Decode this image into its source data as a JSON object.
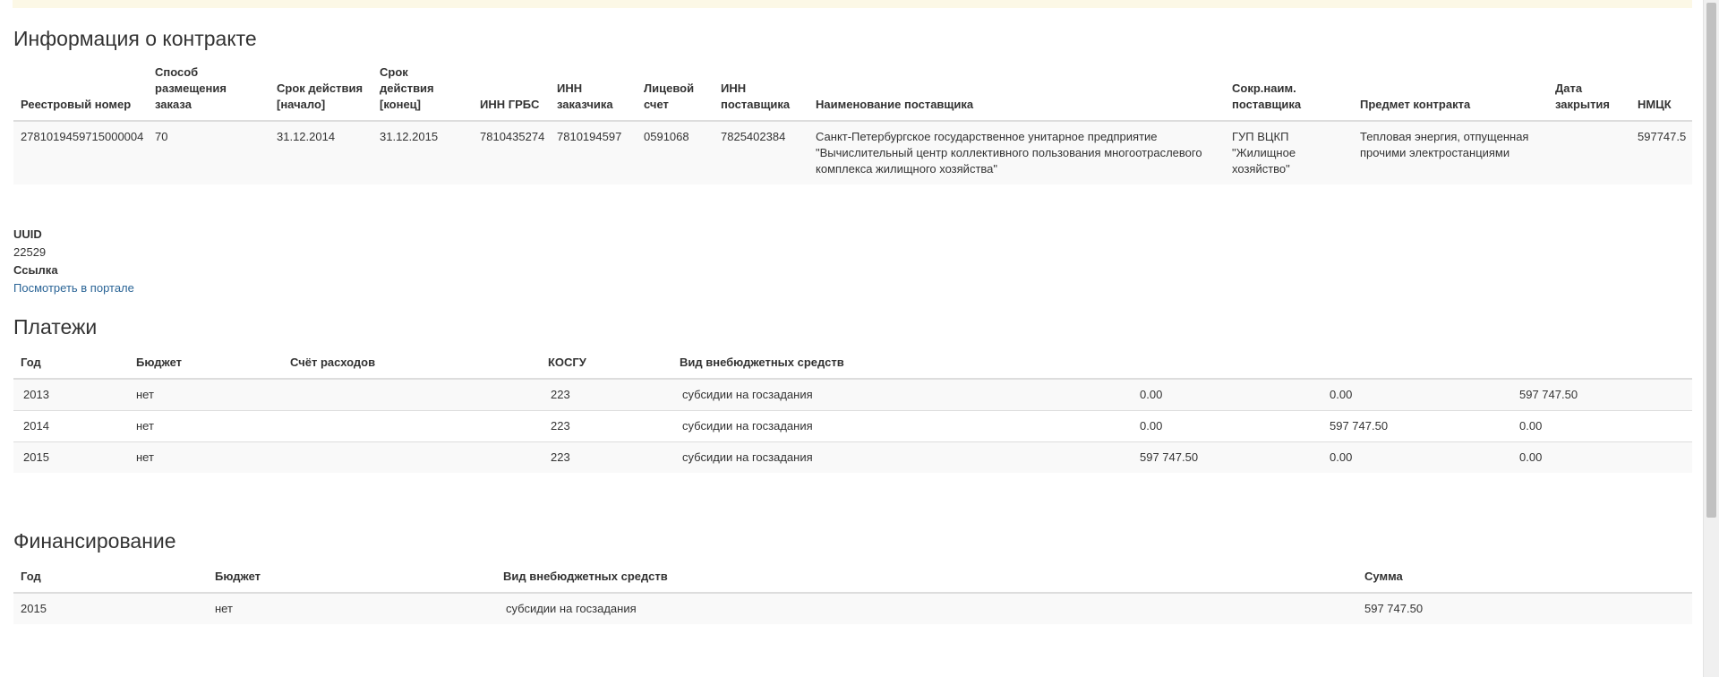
{
  "contract": {
    "title": "Информация о контракте",
    "headers": [
      "Реестровый номер",
      "Способ размещения заказа",
      "Срок действия [начало]",
      "Срок действия [конец]",
      "ИНН ГРБС",
      "ИНН заказчика",
      "Лицевой счет",
      "ИНН поставщика",
      "Наименование поставщика",
      "Сокр.наим. поставщика",
      "Предмет контракта",
      "Дата закрытия",
      "НМЦК"
    ],
    "row": [
      "2781019459715000004",
      "70",
      "31.12.2014",
      "31.12.2015",
      "7810435274",
      "7810194597",
      "0591068",
      "7825402384",
      "Санкт-Петербургское государственное унитарное предприятие \"Вычислительный центр коллективного пользования многоотраслевого комплекса жилищного хозяйства\"",
      "ГУП ВЦКП \"Жилищное хозяйство\"",
      "Тепловая энергия, отпущенная прочими электростанциями",
      "",
      "597747.5"
    ]
  },
  "meta": {
    "uuid_label": "UUID",
    "uuid_value": "22529",
    "link_label": "Ссылка",
    "link_text": "Посмотреть в портале"
  },
  "payments": {
    "title": "Платежи",
    "headers": [
      "Год",
      "Бюджет",
      "Счёт расходов",
      "КОСГУ",
      "Вид внебюджетных средств",
      "",
      "",
      ""
    ],
    "rows": [
      [
        "2013",
        "нет",
        "",
        "223",
        "субсидии на госзадания",
        "0.00",
        "0.00",
        "597 747.50"
      ],
      [
        "2014",
        "нет",
        "",
        "223",
        "субсидии на госзадания",
        "0.00",
        "597 747.50",
        "0.00"
      ],
      [
        "2015",
        "нет",
        "",
        "223",
        "субсидии на госзадания",
        "597 747.50",
        "0.00",
        "0.00"
      ]
    ]
  },
  "financing": {
    "title": "Финансирование",
    "headers": [
      "Год",
      "Бюджет",
      "Вид внебюджетных средств",
      "Сумма"
    ],
    "rows": [
      [
        "2015",
        "нет",
        "субсидии на госзадания",
        "597 747.50"
      ]
    ]
  }
}
